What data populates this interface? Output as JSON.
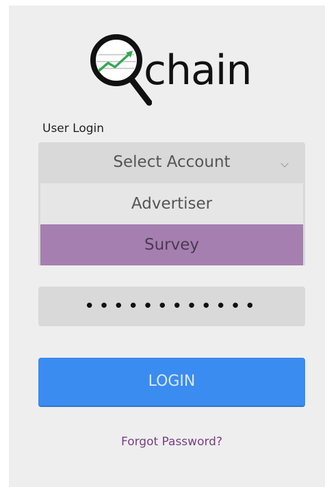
{
  "logo": {
    "text": "chain",
    "icon": "magnifier-trend-icon"
  },
  "login": {
    "section_label": "User Login",
    "account_select": {
      "value": "Select Account",
      "options": [
        "Advertiser",
        "Survey"
      ],
      "highlighted_option": "Survey"
    },
    "password": {
      "value": "••••••••••••"
    },
    "login_label": "LOGIN",
    "forgot_label": "Forgot Password?"
  },
  "colors": {
    "panel_bg": "#eeeeee",
    "field_bg": "#d9d9d9",
    "highlight": "#a57fb0",
    "login_button": "#3b8cf0",
    "link": "#7a3d86"
  }
}
